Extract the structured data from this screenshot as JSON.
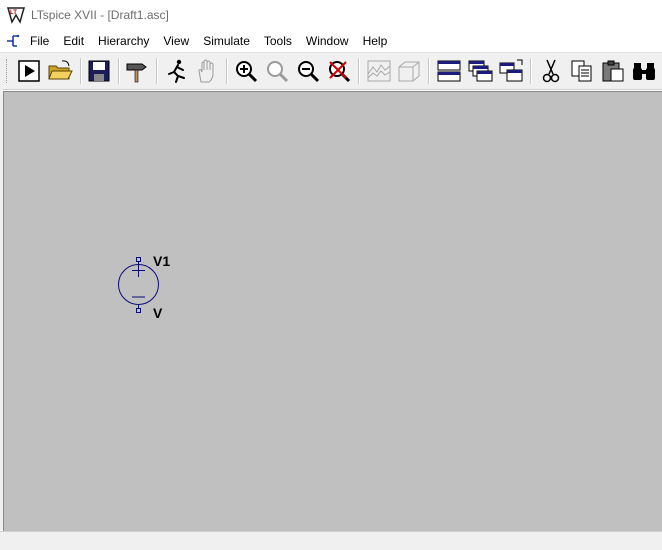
{
  "window": {
    "title": "LTspice XVII - [Draft1.asc]"
  },
  "menu": {
    "items": [
      {
        "label": "File"
      },
      {
        "label": "Edit"
      },
      {
        "label": "Hierarchy"
      },
      {
        "label": "View"
      },
      {
        "label": "Simulate"
      },
      {
        "label": "Tools"
      },
      {
        "label": "Window"
      },
      {
        "label": "Help"
      }
    ]
  },
  "toolbar": {
    "buttons": [
      {
        "icon": "run-icon"
      },
      {
        "icon": "open-folder-icon"
      },
      {
        "icon": "save-icon"
      },
      {
        "icon": "hammer-icon"
      },
      {
        "icon": "runner-icon"
      },
      {
        "icon": "hand-icon"
      },
      {
        "icon": "zoom-in-icon"
      },
      {
        "icon": "zoom-fit-icon"
      },
      {
        "icon": "zoom-out-icon"
      },
      {
        "icon": "zoom-cancel-icon"
      },
      {
        "icon": "waveform-icon"
      },
      {
        "icon": "box-3d-icon"
      },
      {
        "icon": "tile-horizontal-icon"
      },
      {
        "icon": "cascade-icon"
      },
      {
        "icon": "tile-vertical-icon"
      },
      {
        "icon": "cut-icon"
      },
      {
        "icon": "copy-icon"
      },
      {
        "icon": "paste-icon"
      },
      {
        "icon": "find-icon"
      }
    ]
  },
  "schematic": {
    "component": {
      "name": "V1",
      "value": "V",
      "stroke_color": "#0a0a78"
    }
  },
  "colors": {
    "canvas": "#c0c0c0",
    "toolbar": "#f0f0f0"
  }
}
